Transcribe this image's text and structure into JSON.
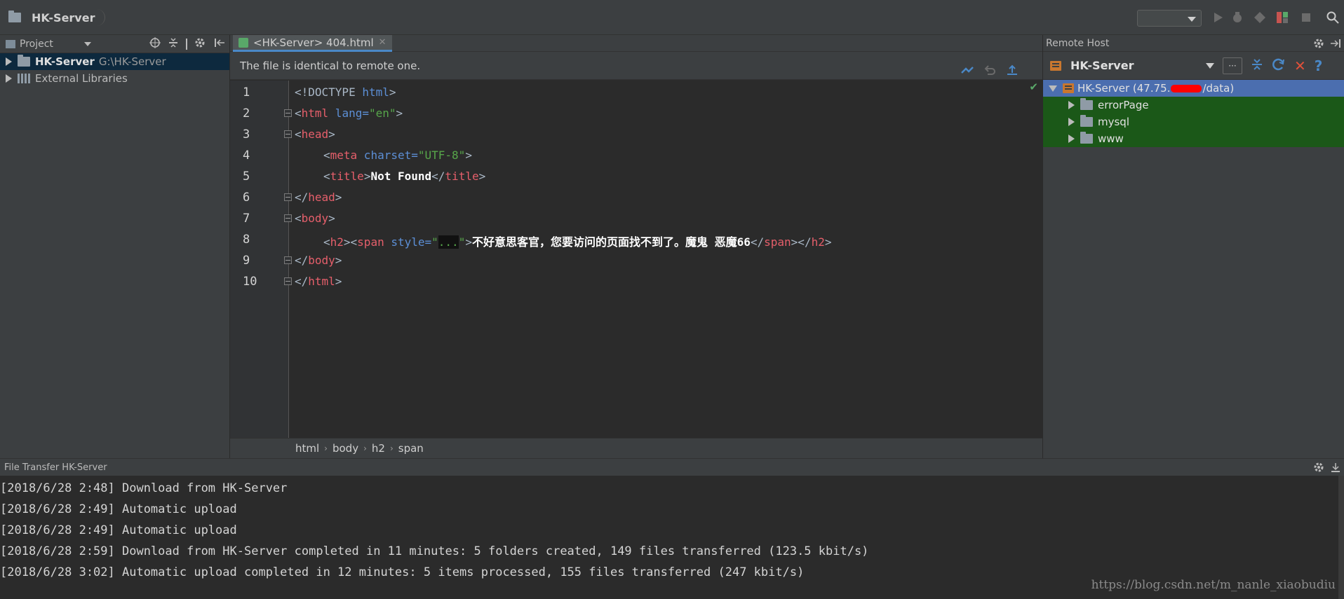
{
  "navbar": {
    "project_name": "HK-Server",
    "run_config_value": "",
    "icons": [
      "folder-icon",
      "run-icon",
      "debug-icon",
      "coverage-icon",
      "rerun-icon",
      "stop-icon",
      "search-icon"
    ]
  },
  "project_panel": {
    "title": "Project",
    "items": [
      {
        "label": "HK-Server",
        "path": "G:\\HK-Server",
        "selected": true
      },
      {
        "label": "External Libraries"
      }
    ]
  },
  "editor": {
    "tab_label": "<HK-Server> 404.html",
    "notice": "The file is identical to remote one.",
    "line_numbers": [
      "1",
      "2",
      "3",
      "4",
      "5",
      "6",
      "7",
      "8",
      "9",
      "10"
    ],
    "breadcrumb": [
      "html",
      "body",
      "h2",
      "span"
    ],
    "colors": {
      "tag": "#e65f6b",
      "attr": "#5c8fd6",
      "value": "#57a64a"
    }
  },
  "code": {
    "l1_doctype": "<!DOCTYPE ",
    "l1_html": "html",
    "l1_close": ">",
    "l2_open": "<",
    "l2_tag": "html",
    "l2_attr": " lang=",
    "l2_val": "\"en\"",
    "l2_close": ">",
    "l3_open": "<",
    "l3_tag": "head",
    "l3_close": ">",
    "l4_open": "<",
    "l4_tag": "meta",
    "l4_attr": " charset=",
    "l4_val": "\"UTF-8\"",
    "l4_close": ">",
    "l5_open": "<",
    "l5_tag": "title",
    "l5_mid1": ">",
    "l5_text": "Not Found",
    "l5_open2": "</",
    "l5_tag2": "title",
    "l5_close": ">",
    "l6_open": "</",
    "l6_tag": "head",
    "l6_close": ">",
    "l7_open": "<",
    "l7_tag": "body",
    "l7_close": ">",
    "l8_open1": "<",
    "l8_tag1": "h2",
    "l8_mid1": "><",
    "l8_tag2": "span",
    "l8_attr": " style=",
    "l8_q1": "\"",
    "l8_hidden": "...",
    "l8_q2": "\"",
    "l8_mid2": ">",
    "l8_text": "不好意思客官，您要访问的页面找不到了。魔鬼 恶魔66",
    "l8_open3": "</",
    "l8_tag3": "span",
    "l8_mid3": "></",
    "l8_tag4": "h2",
    "l8_close": ">",
    "l9_open": "</",
    "l9_tag": "body",
    "l9_close": ">",
    "l10_open": "</",
    "l10_tag": "html",
    "l10_close": ">"
  },
  "remote_panel": {
    "title": "Remote Host",
    "server": "HK-Server",
    "ellipsis": "···",
    "root_prefix": "HK-Server (47.75.",
    "root_suffix": "/data)",
    "children": [
      "errorPage",
      "mysql",
      "www"
    ]
  },
  "transfer_panel": {
    "title": "File Transfer HK-Server",
    "log": [
      "[2018/6/28 2:48] Download from HK-Server",
      "[2018/6/28 2:49] Automatic upload",
      "[2018/6/28 2:49] Automatic upload",
      "[2018/6/28 2:59] Download from HK-Server completed in 11 minutes: 5 folders created, 149 files transferred (123.5 kbit/s)",
      "[2018/6/28 3:02] Automatic upload completed in 12 minutes: 5 items processed, 155 files transferred (247 kbit/s)"
    ]
  },
  "watermark": "https://blog.csdn.net/m_nanle_xiaobudiu"
}
